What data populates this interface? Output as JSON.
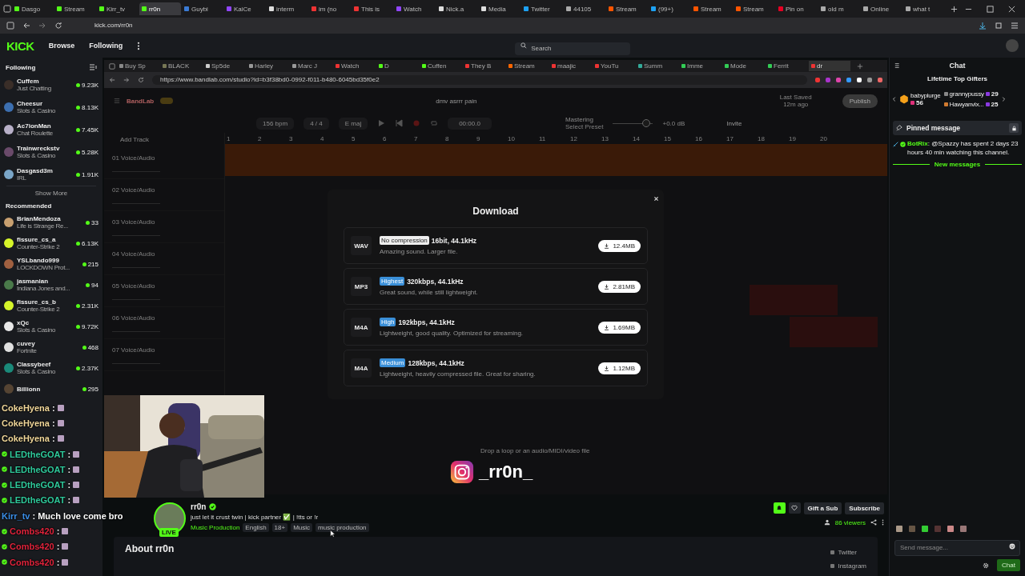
{
  "browser": {
    "tabs": [
      {
        "label": "Dasgo",
        "selected": false
      },
      {
        "label": "Stream",
        "selected": false
      },
      {
        "label": "Kirr_tv",
        "selected": false
      },
      {
        "label": "rr0n",
        "selected": true
      },
      {
        "label": "Guybi",
        "selected": false
      },
      {
        "label": "KaiCe",
        "selected": false
      },
      {
        "label": "interm",
        "selected": false
      },
      {
        "label": "im (no",
        "selected": false
      },
      {
        "label": "This is",
        "selected": false
      },
      {
        "label": "Watch",
        "selected": false
      },
      {
        "label": "Nick.a",
        "selected": false
      },
      {
        "label": "Media",
        "selected": false
      },
      {
        "label": "Twitter",
        "selected": false
      },
      {
        "label": "44105",
        "selected": false
      },
      {
        "label": "Stream",
        "selected": false
      },
      {
        "label": "(99+)",
        "selected": false
      },
      {
        "label": "Stream",
        "selected": false
      },
      {
        "label": "Stream",
        "selected": false
      },
      {
        "label": "Pin on",
        "selected": false
      },
      {
        "label": "old m",
        "selected": false
      },
      {
        "label": "Online",
        "selected": false
      },
      {
        "label": "what t",
        "selected": false
      }
    ],
    "address": "kick.com/rr0n"
  },
  "header": {
    "logo": "KICK",
    "nav": [
      "Browse",
      "Following"
    ],
    "search": {
      "placeholder": "Search"
    }
  },
  "sidebar": {
    "following_title": "Following",
    "following": [
      {
        "name": "Cuffem",
        "category": "Just Chatting",
        "viewers": "9.23K"
      },
      {
        "name": "Cheesur",
        "category": "Slots & Casino",
        "viewers": "8.13K"
      },
      {
        "name": "Ac7ionMan",
        "category": "Chat Roulette",
        "viewers": "7.45K"
      },
      {
        "name": "Trainwreckstv",
        "category": "Slots & Casino",
        "viewers": "5.28K"
      },
      {
        "name": "Dasgasd3m",
        "category": "IRL",
        "viewers": "1.91K"
      }
    ],
    "show_more": "Show More",
    "recommended_title": "Recommended",
    "recommended": [
      {
        "name": "BrianMendoza",
        "category": "Life is Strange Re...",
        "viewers": "33"
      },
      {
        "name": "fissure_cs_a",
        "category": "Counter-Strike 2",
        "viewers": "6.13K"
      },
      {
        "name": "YSLbando999",
        "category": "LOCKDOWN Prot...",
        "viewers": "215"
      },
      {
        "name": "jasmanian",
        "category": "Indiana Jones and...",
        "viewers": "94"
      },
      {
        "name": "fissure_cs_b",
        "category": "Counter-Strike 2",
        "viewers": "2.31K"
      },
      {
        "name": "xQc",
        "category": "Slots & Casino",
        "viewers": "9.72K"
      },
      {
        "name": "cuvey",
        "category": "Fortnite",
        "viewers": "468"
      },
      {
        "name": "Classybeef",
        "category": "Slots & Casino",
        "viewers": "2.37K"
      },
      {
        "name": "Billionn",
        "viewers": "295"
      }
    ]
  },
  "stream": {
    "inner_browser": {
      "tabs": [
        {
          "label": "Buy Sp",
          "selected": false
        },
        {
          "label": "BLACK",
          "selected": false
        },
        {
          "label": "Sp5de",
          "selected": false
        },
        {
          "label": "Harley",
          "selected": false
        },
        {
          "label": "Marc J",
          "selected": false
        },
        {
          "label": "Watch",
          "selected": false
        },
        {
          "label": "D",
          "selected": false
        },
        {
          "label": "Cuffen",
          "selected": false
        },
        {
          "label": "They B",
          "selected": false
        },
        {
          "label": "Stream",
          "selected": false
        },
        {
          "label": "maajic",
          "selected": false
        },
        {
          "label": "YouTu",
          "selected": false
        },
        {
          "label": "Summ",
          "selected": false
        },
        {
          "label": "Imme",
          "selected": false
        },
        {
          "label": "Mode",
          "selected": false
        },
        {
          "label": "Ferrit",
          "selected": false
        },
        {
          "label": "dr",
          "selected": true
        }
      ],
      "url": "https://www.bandlab.com/studio?id=b3f38bd0-0992-f011-b480-6045bd35f0e2"
    },
    "bandlab": {
      "brand": "BandLab",
      "project": "dmv asrrr pain",
      "saved": "Last Saved",
      "saved_time": "12m ago",
      "publish": "Publish",
      "tempo": "156",
      "tempo_unit": "bpm",
      "meter": "4 / 4",
      "key": "E maj",
      "time": "00:00.0",
      "mastering": "Mastering",
      "preset": "Select Preset",
      "volume": {
        "level": 0.84
      },
      "gain": "+0.0 dB",
      "invite": "Invite",
      "add_track": "Add Track",
      "ruler": [
        "1",
        "2",
        "3",
        "4",
        "5",
        "6",
        "7",
        "8",
        "9",
        "10",
        "11",
        "12",
        "13",
        "14",
        "15",
        "16",
        "17",
        "18",
        "19",
        "20"
      ],
      "tracks": [
        {
          "name": "01 Voice/Audio"
        },
        {
          "name": "02 Voice/Audio"
        },
        {
          "name": "03 Voice/Audio"
        },
        {
          "name": "04 Voice/Audio"
        },
        {
          "name": "05 Voice/Audio"
        },
        {
          "name": "06 Voice/Audio"
        },
        {
          "name": "07 Voice/Audio"
        }
      ],
      "drop_hint": "Drop a loop or an audio/MIDI/video file"
    },
    "download_dialog": {
      "title": "Download",
      "options": [
        {
          "format": "WAV",
          "badge": "No compression",
          "kind": "plain",
          "spec": "16bit, 44.1kHz",
          "description": "Amazing sound. Larger file.",
          "size": "12.4MB"
        },
        {
          "format": "MP3",
          "badge": "Highest",
          "kind": "accent",
          "spec": "320kbps, 44.1kHz",
          "description": "Great sound, while still lightweight.",
          "size": "2.81MB"
        },
        {
          "format": "M4A",
          "badge": "High",
          "kind": "accent",
          "spec": "192kbps, 44.1kHz",
          "description": "Lightweight, good quality. Optimized for streaming.",
          "size": "1.69MB"
        },
        {
          "format": "M4A",
          "badge": "Medium",
          "kind": "accent",
          "spec": "128kbps, 44.1kHz",
          "description": "Lightweight, heavily compressed file. Great for sharing.",
          "size": "1.12MB"
        }
      ]
    },
    "overlay_chat": [
      {
        "user": "CokeHyena",
        "color": "#f0d79a",
        "verified": false,
        "text": ":",
        "emote": true
      },
      {
        "user": "CokeHyena",
        "color": "#f0d79a",
        "verified": false,
        "text": ":",
        "emote": true
      },
      {
        "user": "CokeHyena",
        "color": "#f0d79a",
        "verified": false,
        "text": ":",
        "emote": true
      },
      {
        "user": "LEDtheGOAT",
        "color": "#2fc99b",
        "verified": true,
        "text": ":",
        "emote": true
      },
      {
        "user": "LEDtheGOAT",
        "color": "#2fc99b",
        "verified": true,
        "text": ":",
        "emote": true
      },
      {
        "user": "LEDtheGOAT",
        "color": "#2fc99b",
        "verified": true,
        "text": ":",
        "emote": true
      },
      {
        "user": "LEDtheGOAT",
        "color": "#2fc99b",
        "verified": true,
        "text": ":",
        "emote": true
      },
      {
        "user": "Kirr_tv",
        "color": "#3b8fe8",
        "verified": false,
        "text": ": Much love come bro",
        "emote": false
      },
      {
        "user": "Combs420",
        "color": "#e0243c",
        "verified": true,
        "text": ":",
        "emote": true
      },
      {
        "user": "Combs420",
        "color": "#e0243c",
        "verified": true,
        "text": ":",
        "emote": true
      },
      {
        "user": "Combs420",
        "color": "#e0243c",
        "verified": true,
        "text": ":",
        "emote": true
      }
    ],
    "instagram": "_rr0n_"
  },
  "channel": {
    "name": "rr0n",
    "verified": true,
    "live_badge": "LIVE",
    "description": "just let it crust twin | kick partner ✅ | !tts or !r",
    "category": "Music Production",
    "tags": [
      "English",
      "18+",
      "Music",
      "music production"
    ],
    "buttons": [
      "Gift a Sub",
      "Subscribe"
    ],
    "viewers": "86 viewers",
    "about_title": "About rr0n",
    "socials": [
      "Twitter",
      "Instagram"
    ]
  },
  "chat": {
    "title": "Chat",
    "gifters_title": "Lifetime Top Gifters",
    "gifters": [
      {
        "name": "babyplurge",
        "count": "56"
      },
      {
        "name": "grannypussy",
        "count": "29"
      },
      {
        "name": "Hawyanvix...",
        "count": "25"
      }
    ],
    "pinned_title": "Pinned message",
    "pinned": {
      "user": "BotRix",
      "text": ": @Spazzy has spent 2 days 23 hours 40 min watching this channel."
    },
    "new_messages": "New messages",
    "input": {
      "placeholder": "Send message..."
    },
    "send": "Chat"
  }
}
